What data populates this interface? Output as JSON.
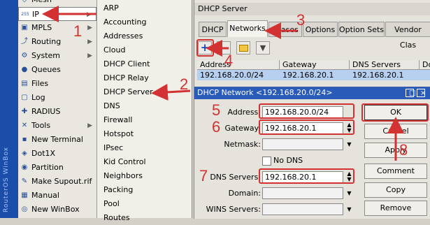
{
  "colors": {
    "annotation": "#d23232",
    "title_bar": "#2a5bb8",
    "selection": "#b8d0f0"
  },
  "main_menu": {
    "items": [
      {
        "label": "Mesh",
        "icon": "mesh-icon",
        "has_arrow": false
      },
      {
        "label": "IP",
        "icon": "ip-icon",
        "has_arrow": true
      },
      {
        "label": "MPLS",
        "icon": "mpls-icon",
        "has_arrow": true
      },
      {
        "label": "Routing",
        "icon": "routing-icon",
        "has_arrow": true
      },
      {
        "label": "System",
        "icon": "system-icon",
        "has_arrow": true
      },
      {
        "label": "Queues",
        "icon": "queues-icon",
        "has_arrow": false
      },
      {
        "label": "Files",
        "icon": "files-icon",
        "has_arrow": false
      },
      {
        "label": "Log",
        "icon": "log-icon",
        "has_arrow": false
      },
      {
        "label": "RADIUS",
        "icon": "radius-icon",
        "has_arrow": false
      },
      {
        "label": "Tools",
        "icon": "tools-icon",
        "has_arrow": true
      },
      {
        "label": "New Terminal",
        "icon": "terminal-icon",
        "has_arrow": false
      },
      {
        "label": "Dot1X",
        "icon": "dot1x-icon",
        "has_arrow": false
      },
      {
        "label": "Partition",
        "icon": "partition-icon",
        "has_arrow": false
      },
      {
        "label": "Make Supout.rif",
        "icon": "supout-icon",
        "has_arrow": false
      },
      {
        "label": "Manual",
        "icon": "manual-icon",
        "has_arrow": false
      },
      {
        "label": "New WinBox",
        "icon": "winbox-icon",
        "has_arrow": false
      }
    ]
  },
  "sub_menu": {
    "items": [
      "ARP",
      "Accounting",
      "Addresses",
      "Cloud",
      "DHCP Client",
      "DHCP Relay",
      "DHCP Server",
      "DNS",
      "Firewall",
      "Hotspot",
      "IPsec",
      "Kid Control",
      "Neighbors",
      "Packing",
      "Pool",
      "Routes"
    ]
  },
  "dhcp_server": {
    "title": "DHCP Server",
    "tabs": [
      "DHCP",
      "Networks",
      "Leases",
      "Options",
      "Option Sets",
      "Vendor Clas"
    ],
    "columns": [
      "Address",
      "Gateway",
      "DNS Servers",
      "Do"
    ],
    "row": {
      "address": "192.168.20.0/24",
      "gateway": "192.168.20.1",
      "dns": "192.168.20.1"
    }
  },
  "dhcp_network": {
    "title": "DHCP Network <192.168.20.0/24>",
    "fields": {
      "address": {
        "label": "Address:",
        "value": "192.168.20.0/24"
      },
      "gateway": {
        "label": "Gateway:",
        "value": "192.168.20.1"
      },
      "netmask": {
        "label": "Netmask:",
        "value": ""
      },
      "no_dns": {
        "label": "No DNS"
      },
      "dns": {
        "label": "DNS Servers:",
        "value": "192.168.20.1"
      },
      "domain": {
        "label": "Domain:",
        "value": ""
      },
      "wins": {
        "label": "WINS Servers:",
        "value": ""
      }
    },
    "buttons": {
      "ok": "OK",
      "cancel": "Cancel",
      "apply": "Apply",
      "comment": "Comment",
      "copy": "Copy",
      "remove": "Remove"
    }
  },
  "annotations": [
    "1",
    "2",
    "3",
    "4",
    "5",
    "6",
    "7",
    "8"
  ],
  "side_strip_text": "RouterOS WinBox"
}
